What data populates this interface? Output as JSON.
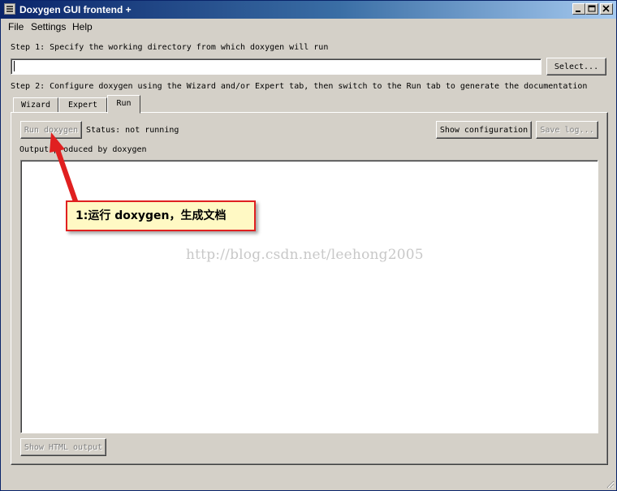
{
  "window": {
    "title": "Doxygen GUI frontend +"
  },
  "menu": [
    "File",
    "Settings",
    "Help"
  ],
  "step1": {
    "text": "Step 1: Specify the working directory from which doxygen will run",
    "input_value": "",
    "select_label": "Select..."
  },
  "step2": {
    "text": "Step 2: Configure doxygen using the Wizard and/or Expert tab, then switch to the Run tab to generate the documentation"
  },
  "tabs": [
    {
      "label": "Wizard",
      "active": false
    },
    {
      "label": "Expert",
      "active": false
    },
    {
      "label": "Run",
      "active": true
    }
  ],
  "run": {
    "run_label": "Run doxygen",
    "status": "Status: not running",
    "show_config_label": "Show configuration",
    "save_log_label": "Save log...",
    "output_label": "Output produced by doxygen",
    "output_text": "",
    "show_html_label": "Show HTML output"
  },
  "annotation": {
    "text": "1:运行 doxygen，生成文档",
    "color": "#e02020"
  },
  "watermark": "http://blog.csdn.net/leehong2005"
}
